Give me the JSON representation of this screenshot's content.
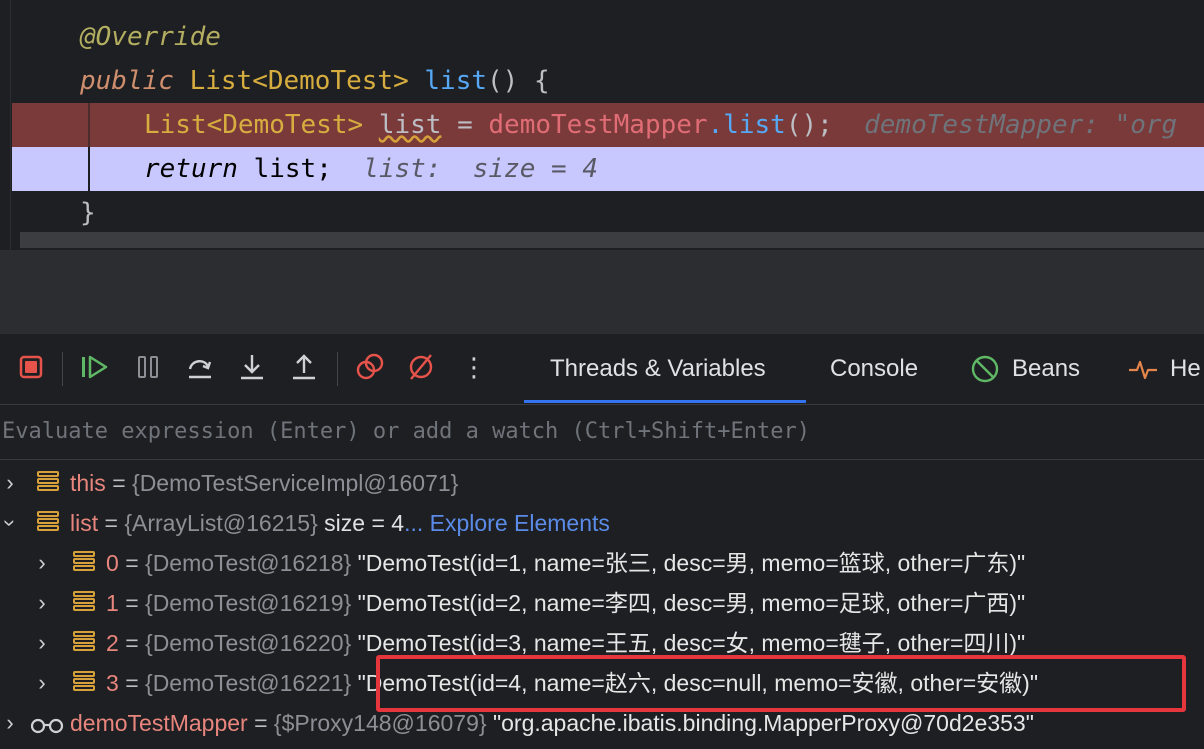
{
  "editor": {
    "lines": [
      {
        "annotation": "@Override"
      },
      {
        "keyword": "public",
        "type": "List<DemoTest>",
        "method": "list",
        "rest": "() {"
      },
      {
        "type": "List<DemoTest>",
        "var": "list",
        "op": "=",
        "field": "demoTestMapper",
        "method": ".list",
        "rest": "();",
        "inlay": "demoTestMapper: \"org"
      },
      {
        "keyword": "return",
        "var": "list;",
        "inlay": "list:  size = 4"
      },
      {
        "rest": "}"
      }
    ]
  },
  "toolbar": {
    "icons": [
      "stop-icon",
      "resume-icon",
      "pause-icon",
      "step-over-icon",
      "step-into-icon",
      "step-out-icon",
      "view-breakpoints-icon",
      "mute-breakpoints-icon",
      "more-icon"
    ],
    "tabs": {
      "threads": "Threads & Variables",
      "console": "Console",
      "beans": "Beans",
      "health": "He"
    },
    "colors": {
      "stop": "#e5534b",
      "resume": "#5fb865",
      "accent": "#3574f0"
    }
  },
  "evaluate": {
    "placeholder": "Evaluate expression (Enter) or add a watch (Ctrl+Shift+Enter)"
  },
  "variables": {
    "this": {
      "name": "this",
      "eq": "=",
      "ref": "{DemoTestServiceImpl@16071}"
    },
    "list": {
      "name": "list",
      "eq": "=",
      "ref": "{ArrayList@16215}",
      "size": "size = 4",
      "dots": "...",
      "link": "Explore Elements"
    },
    "items": [
      {
        "index": "0",
        "eq": "=",
        "ref": "{DemoTest@16218}",
        "value": "\"DemoTest(id=1, name=张三, desc=男, memo=篮球, other=广东)\""
      },
      {
        "index": "1",
        "eq": "=",
        "ref": "{DemoTest@16219}",
        "value": "\"DemoTest(id=2, name=李四, desc=男, memo=足球, other=广西)\""
      },
      {
        "index": "2",
        "eq": "=",
        "ref": "{DemoTest@16220}",
        "value": "\"DemoTest(id=3, name=王五, desc=女, memo=毽子, other=四川)\""
      },
      {
        "index": "3",
        "eq": "=",
        "ref": "{DemoTest@16221}",
        "value": "\"DemoTest(id=4, name=赵六, desc=null, memo=安徽, other=安徽)\""
      }
    ],
    "mapper": {
      "name": "demoTestMapper",
      "eq": "=",
      "ref": "{$Proxy148@16079}",
      "value": "\"org.apache.ibatis.binding.MapperProxy@70d2e353\""
    }
  },
  "highlight_color": "#e5363d"
}
